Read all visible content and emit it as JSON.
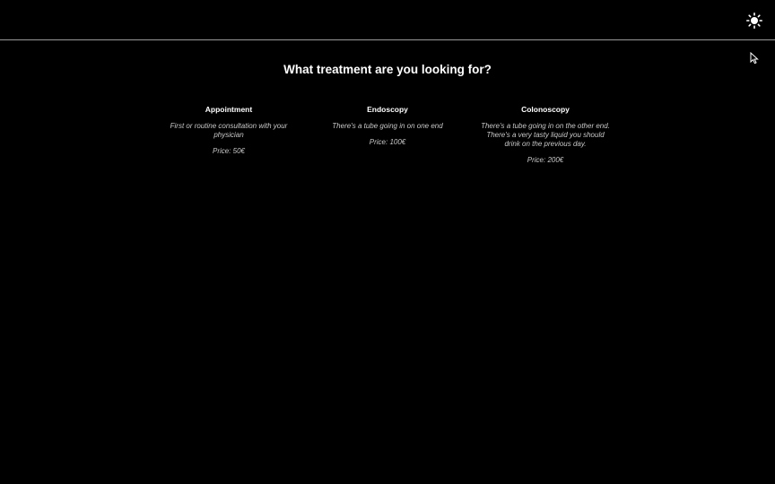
{
  "header": {
    "theme_toggle_icon": "sun-icon"
  },
  "main": {
    "heading": "What treatment are you looking for?",
    "treatments": [
      {
        "title": "Appointment",
        "description": "First or routine consultation with your physician",
        "price": "Price: 50€"
      },
      {
        "title": "Endoscopy",
        "description": "There's a tube going in on one end",
        "price": "Price: 100€"
      },
      {
        "title": "Colonoscopy",
        "description": "There's a tube going in on the other end. There's a very tasty liquid you should drink on the previous day.",
        "price": "Price: 200€"
      }
    ]
  },
  "colors": {
    "background": "#000000",
    "text": "#ffffff",
    "muted_text": "#c8c8c8",
    "divider": "#9a9a9a"
  }
}
